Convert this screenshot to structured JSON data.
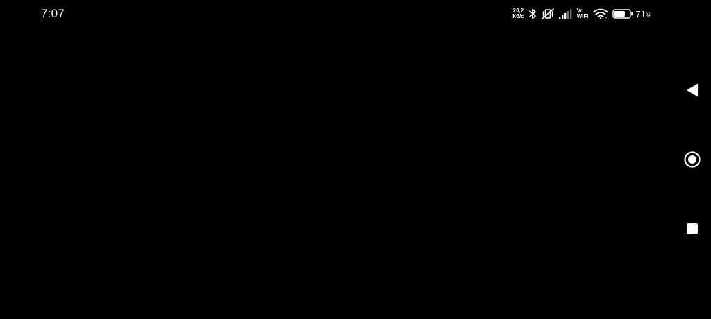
{
  "status_bar": {
    "time": "7:07",
    "net_speed_value": "20,2",
    "net_speed_unit": "Кб/с",
    "vowifi_top": "Vo",
    "vowifi_bottom": "WiFi",
    "battery_percent": "71",
    "battery_sign": "%",
    "battery_level": 0.71,
    "icons": [
      "bluetooth-icon",
      "muted-vibrate-icon",
      "signal-icon",
      "wifi-icon",
      "battery-icon"
    ]
  },
  "nav_bar": {
    "buttons": [
      "back-icon",
      "home-icon",
      "recents-icon"
    ]
  },
  "colors": {
    "background": "#000000",
    "foreground": "#ffffff"
  }
}
